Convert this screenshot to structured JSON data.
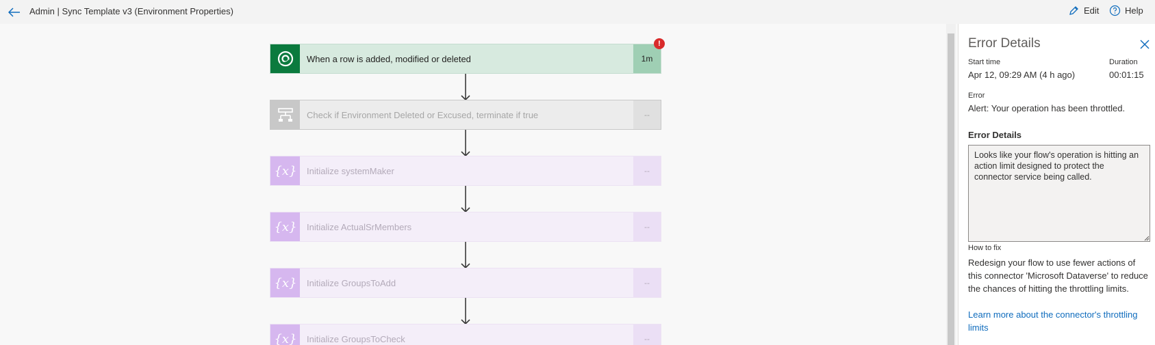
{
  "header": {
    "title": "Admin | Sync Template v3 (Environment Properties)",
    "edit_label": "Edit",
    "help_label": "Help"
  },
  "flow": {
    "steps": [
      {
        "label": "When a row is added, modified or deleted",
        "duration": "1m",
        "status": "error",
        "icon": "dataverse-icon"
      },
      {
        "label": "Check if Environment Deleted or Excused, terminate if true",
        "duration": "--",
        "status": "skipped",
        "icon": "condition-icon"
      },
      {
        "label": "Initialize systemMaker",
        "duration": "--",
        "status": "skipped",
        "icon": "variable-icon"
      },
      {
        "label": "Initialize ActualSrMembers",
        "duration": "--",
        "status": "skipped",
        "icon": "variable-icon"
      },
      {
        "label": "Initialize GroupsToAdd",
        "duration": "--",
        "status": "skipped",
        "icon": "variable-icon"
      },
      {
        "label": "Initialize GroupsToCheck",
        "duration": "--",
        "status": "skipped",
        "icon": "variable-icon"
      }
    ],
    "error_badge": "!"
  },
  "panel": {
    "title": "Error Details",
    "start_time_label": "Start time",
    "start_time_value": "Apr 12, 09:29 AM (4 h ago)",
    "duration_label": "Duration",
    "duration_value": "00:01:15",
    "error_label": "Error",
    "error_value": "Alert: Your operation has been throttled.",
    "details_heading": "Error Details",
    "details_text": "Looks like your flow's operation is hitting an action limit designed to protect the connector service being called.",
    "how_to_fix_label": "How to fix",
    "how_to_fix_text": "Redesign your flow to use fewer actions of this connector 'Microsoft Dataverse' to reduce the chances of hitting the throttling limits.",
    "learn_more_link": "Learn more about the connector's throttling limits"
  },
  "colors": {
    "accent": "#0f6cbd",
    "trigger": "#0b7a3e",
    "error": "#d92b2b",
    "variable": "#d6b7ef"
  }
}
